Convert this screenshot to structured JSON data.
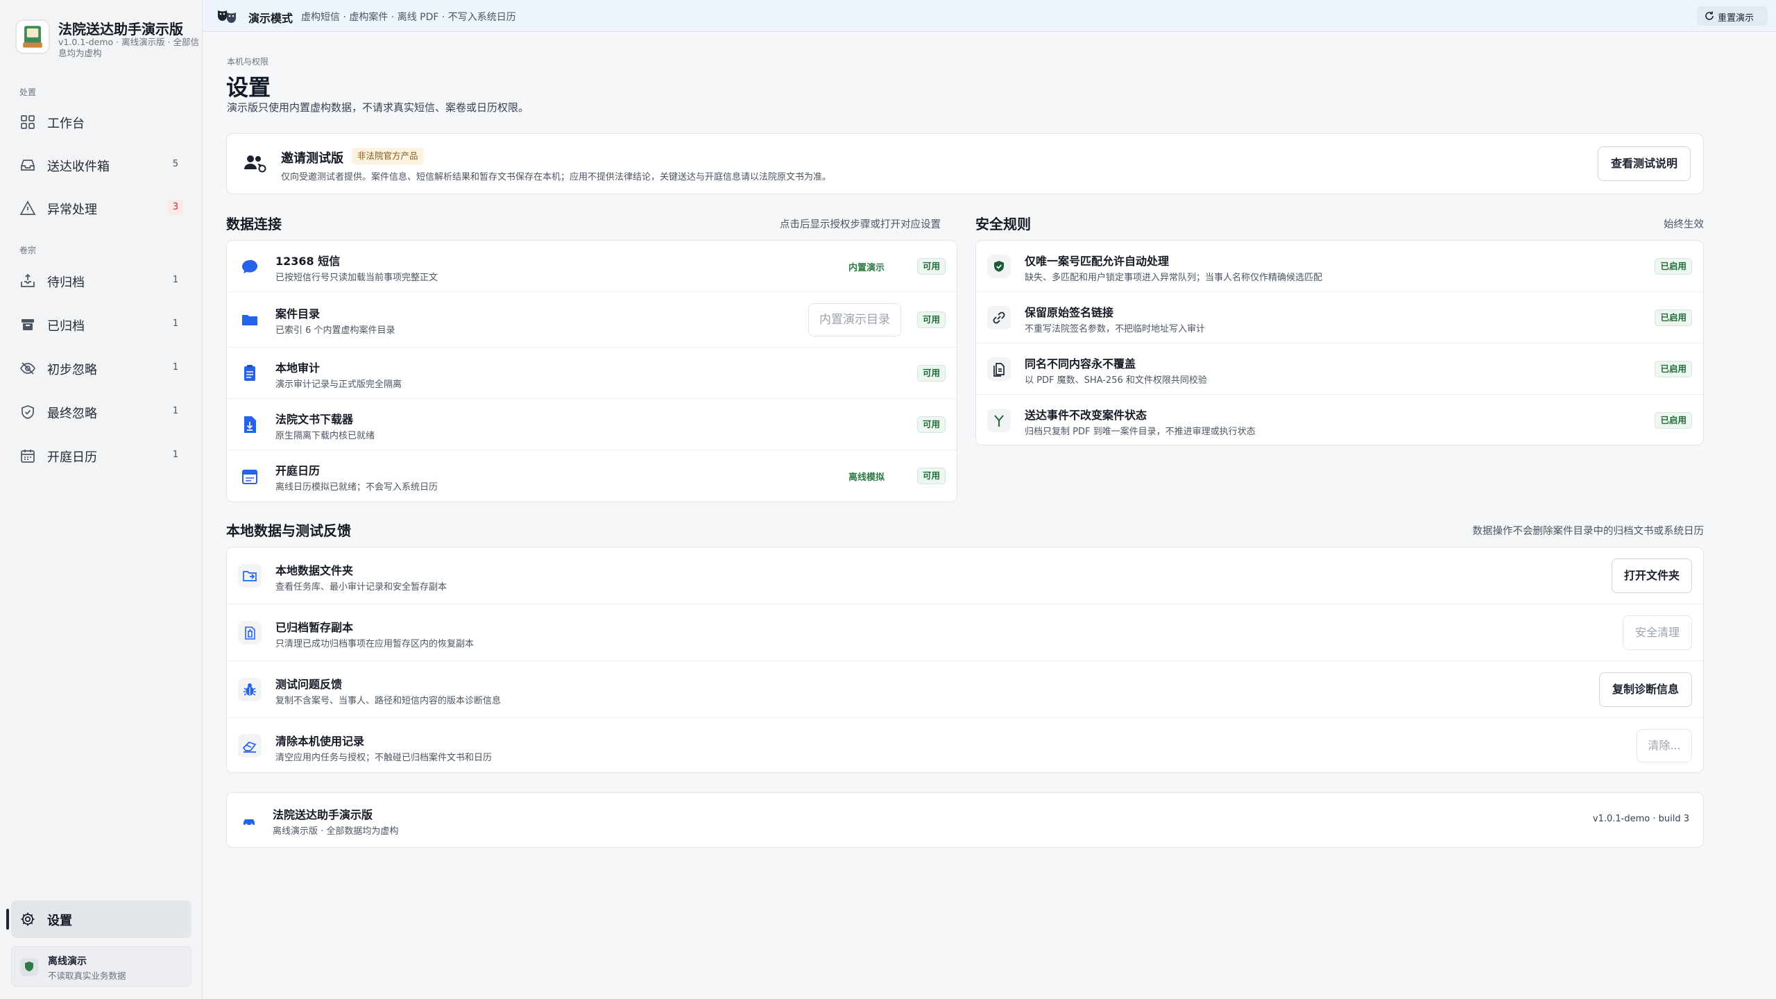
{
  "sidebar": {
    "title": "法院送达助手演示版",
    "subtitle": "v1.0.1-demo · 离线演示版 · 全部信息均为虚构",
    "section_process": "处置",
    "section_archive": "卷宗",
    "items": [
      {
        "label": "工作台",
        "icon": "grid-icon",
        "count": ""
      },
      {
        "label": "送达收件箱",
        "icon": "inbox-icon",
        "count": "5"
      },
      {
        "label": "异常处理",
        "icon": "warning-icon",
        "count": "3"
      },
      {
        "label": "待归档",
        "icon": "upload-tray-icon",
        "count": "1"
      },
      {
        "label": "已归档",
        "icon": "archive-box-icon",
        "count": "1"
      },
      {
        "label": "初步忽略",
        "icon": "eye-off-icon",
        "count": "1"
      },
      {
        "label": "最终忽略",
        "icon": "shield-check-icon",
        "count": "1"
      },
      {
        "label": "开庭日历",
        "icon": "calendar-icon",
        "count": "1"
      }
    ],
    "settings_label": "设置",
    "offline_title": "离线演示",
    "offline_sub": "不读取真实业务数据"
  },
  "topbar": {
    "mode": "演示模式",
    "description": "虚构短信 · 虚构案件 · 离线 PDF · 不写入系统日历",
    "reset_label": "重置演示"
  },
  "page": {
    "breadcrumb": "本机与权限",
    "title": "设置",
    "description": "演示版只使用内置虚构数据，不请求真实短信、案卷或日历权限。"
  },
  "invite": {
    "title": "邀请测试版",
    "tag": "非法院官方产品",
    "description": "仅向受邀测试者提供。案件信息、短信解析结果和暂存文书保存在本机；应用不提供法律结论，关键送达与开庭信息请以法院原文书为准。",
    "button": "查看测试说明"
  },
  "data_connection": {
    "title": "数据连接",
    "note": "点击后显示授权步骤或打开对应设置",
    "rows": [
      {
        "title": "12368 短信",
        "sub": "已按短信行号只读加载当前事项完整正文",
        "tag": "内置演示",
        "status": "可用",
        "icon": "chat-bubble-icon"
      },
      {
        "title": "案件目录",
        "sub": "已索引 6 个内置虚构案件目录",
        "button": "内置演示目录",
        "status": "可用",
        "icon": "folder-icon"
      },
      {
        "title": "本地审计",
        "sub": "演示审计记录与正式版完全隔离",
        "status": "可用",
        "icon": "clipboard-icon"
      },
      {
        "title": "法院文书下载器",
        "sub": "原生隔离下载内核已就绪",
        "status": "可用",
        "icon": "document-download-icon"
      },
      {
        "title": "开庭日历",
        "sub": "离线日历模拟已就绪；不会写入系统日历",
        "tag": "离线模拟",
        "status": "可用",
        "icon": "calendar-icon"
      }
    ]
  },
  "safety_rules": {
    "title": "安全规则",
    "note": "始终生效",
    "rows": [
      {
        "title": "仅唯一案号匹配允许自动处理",
        "sub": "缺失、多匹配和用户锁定事项进入异常队列；当事人名称仅作精确候选匹配",
        "status": "已启用",
        "icon": "shield-check-icon"
      },
      {
        "title": "保留原始签名链接",
        "sub": "不重写法院签名参数，不把临时地址写入审计",
        "status": "已启用",
        "icon": "link-icon"
      },
      {
        "title": "同名不同内容永不覆盖",
        "sub": "以 PDF 魔数、SHA-256 和文件权限共同校验",
        "status": "已启用",
        "icon": "copy-files-icon"
      },
      {
        "title": "送达事件不改变案件状态",
        "sub": "归档只复制 PDF 到唯一案件目录，不推进审理或执行状态",
        "status": "已启用",
        "icon": "fork-icon"
      }
    ]
  },
  "local_data": {
    "title": "本地数据与测试反馈",
    "note": "数据操作不会删除案件目录中的归档文书或系统日历",
    "rows": [
      {
        "title": "本地数据文件夹",
        "sub": "查看任务库、最小审计记录和安全暂存副本",
        "button": "打开文件夹",
        "icon": "folder-open-icon"
      },
      {
        "title": "已归档暂存副本",
        "sub": "只清理已成功归档事项在应用暂存区内的恢复副本",
        "button": "安全清理",
        "icon": "trash-doc-icon"
      },
      {
        "title": "测试问题反馈",
        "sub": "复制不含案号、当事人、路径和短信内容的版本诊断信息",
        "button": "复制诊断信息",
        "icon": "bug-icon"
      },
      {
        "title": "清除本机使用记录",
        "sub": "清空应用内任务与授权；不触碰已归档案件文书和日历",
        "button": "清除...",
        "icon": "eraser-icon"
      }
    ]
  },
  "footer": {
    "title": "法院送达助手演示版",
    "sub": "离线演示版 · 全部数据均为虚构",
    "version": "v1.0.1-demo · build 3"
  },
  "colors": {
    "accent": "#2563eb",
    "success": "#236b3a",
    "warning": "#c53030",
    "sidebar_bg": "#f3f4f6",
    "topbar_bg": "#eef4fb"
  }
}
